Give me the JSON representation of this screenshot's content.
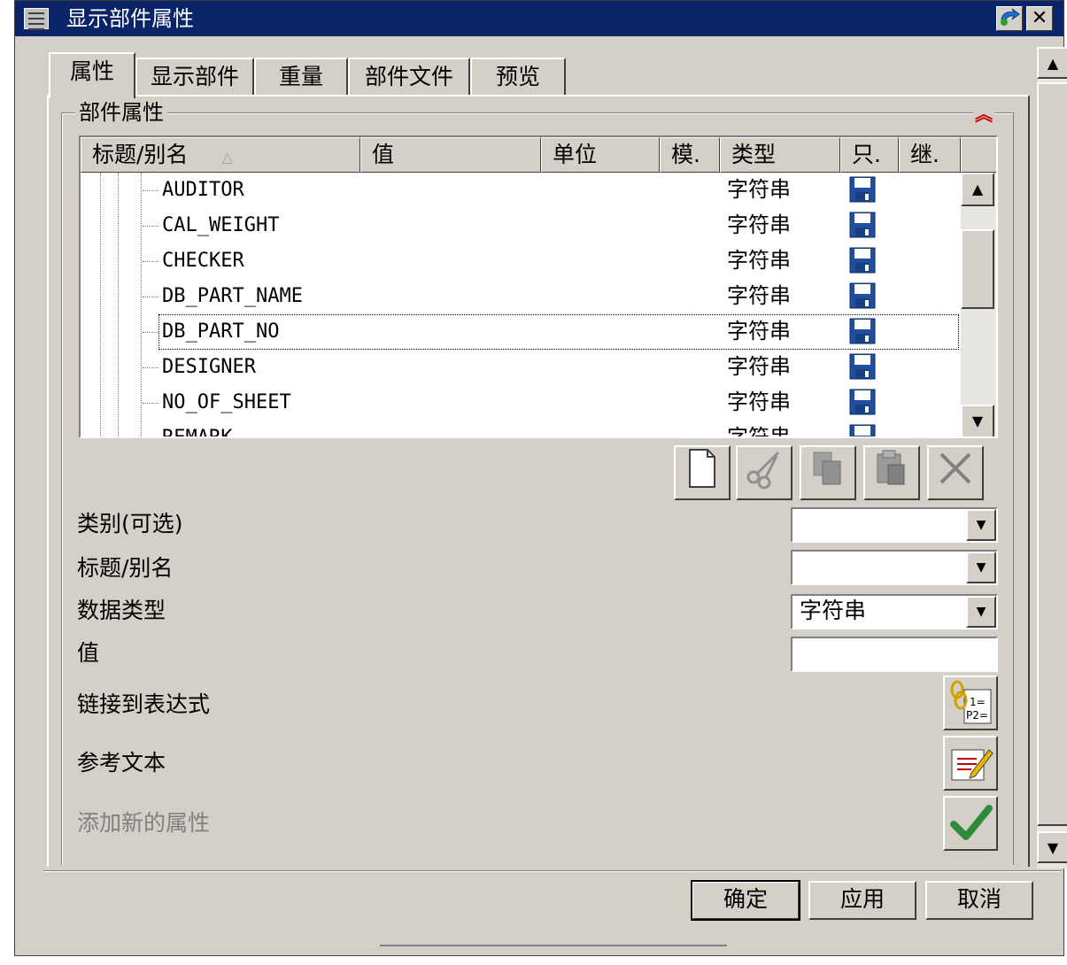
{
  "window": {
    "title": "显示部件属性"
  },
  "tabs": [
    {
      "label": "属性",
      "active": true
    },
    {
      "label": "显示部件",
      "active": false
    },
    {
      "label": "重量",
      "active": false
    },
    {
      "label": "部件文件",
      "active": false
    },
    {
      "label": "预览",
      "active": false
    }
  ],
  "group": {
    "label": "部件属性"
  },
  "table": {
    "columns": [
      "标题/别名",
      "值",
      "单位",
      "模.",
      "类型",
      "只.",
      "继."
    ],
    "sort_indicator": "△",
    "rows": [
      {
        "name": "AUDITOR",
        "type": "字符串"
      },
      {
        "name": "CAL_WEIGHT",
        "type": "字符串"
      },
      {
        "name": "CHECKER",
        "type": "字符串"
      },
      {
        "name": "DB_PART_NAME",
        "type": "字符串"
      },
      {
        "name": "DB_PART_NO",
        "type": "字符串"
      },
      {
        "name": "DESIGNER",
        "type": "字符串",
        "selected": true
      },
      {
        "name": "NO_OF_SHEET",
        "type": "字符串"
      },
      {
        "name": "REMARK",
        "type": "字符串"
      }
    ]
  },
  "form": {
    "category_label": "类别(可选)",
    "title_label": "标题/别名",
    "datatype_label": "数据类型",
    "datatype_value": "字符串",
    "value_label": "值",
    "link_label": "链接到表达式",
    "ref_text_label": "参考文本",
    "add_label": "添加新的属性"
  },
  "buttons": {
    "ok": "确定",
    "apply": "应用",
    "cancel": "取消"
  },
  "colors": {
    "titlebar": "#0a246a",
    "face": "#d4d0c8",
    "check": "#2e8b3a"
  }
}
